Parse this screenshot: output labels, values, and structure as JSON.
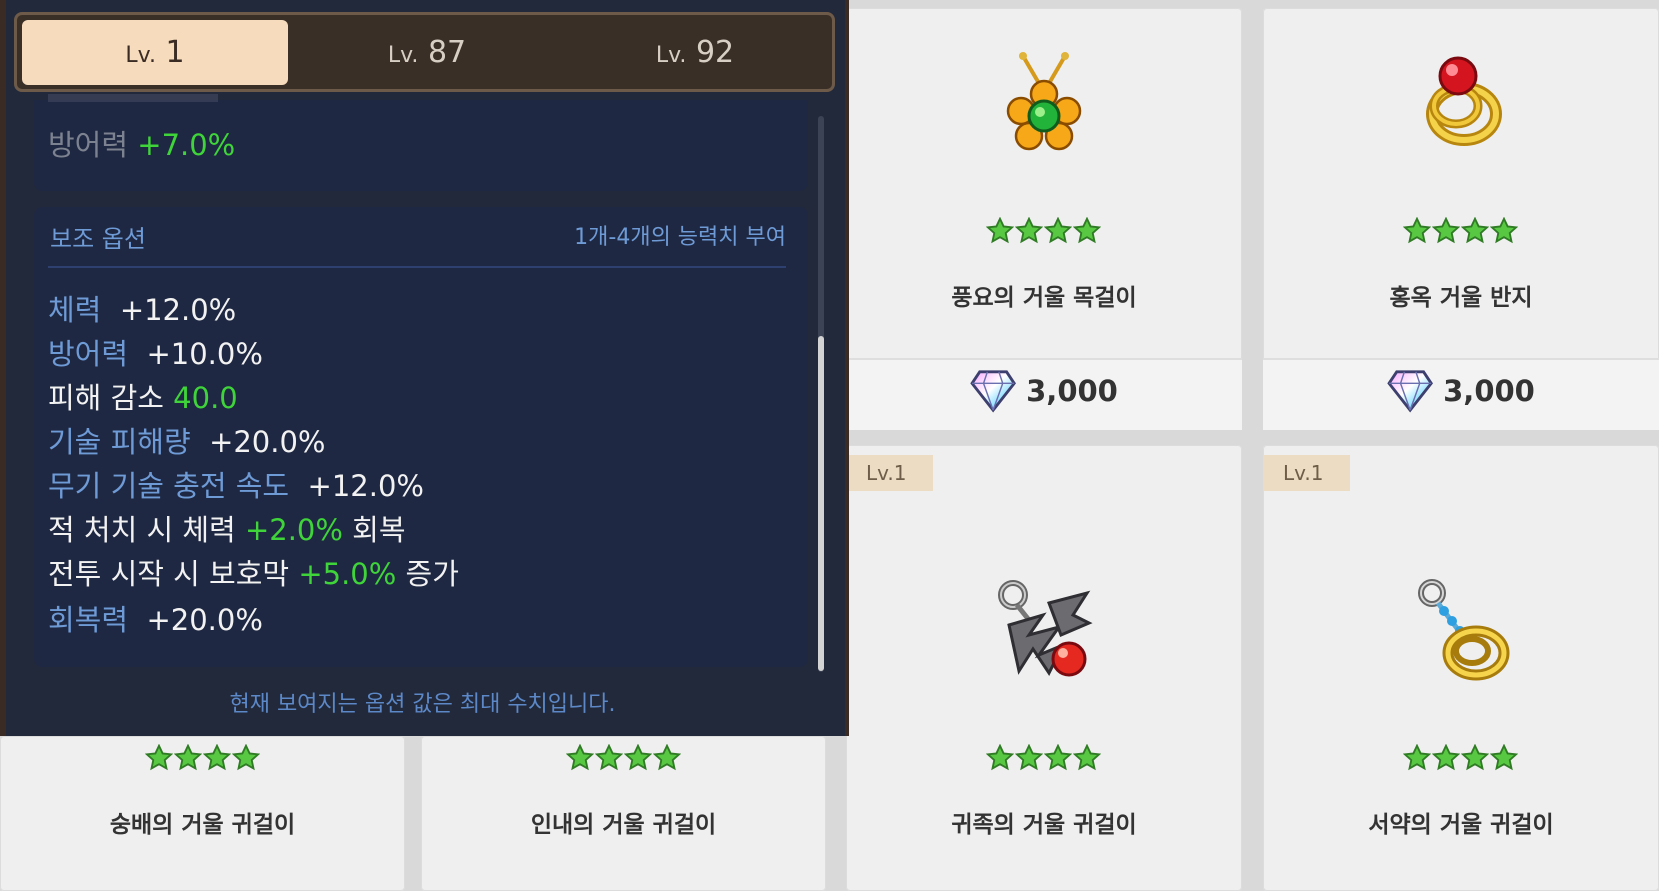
{
  "tabs": [
    {
      "prefix": "Lv.",
      "level": "1"
    },
    {
      "prefix": "Lv.",
      "level": "87"
    },
    {
      "prefix": "Lv.",
      "level": "92"
    }
  ],
  "main_options": {
    "defense_label": "방어력",
    "defense_value": "+7.0%"
  },
  "sub_options": {
    "title": "보조 옵션",
    "note": "1개-4개의 능력치 부여",
    "lines": [
      {
        "label": "체력",
        "value": "+12.0%"
      },
      {
        "label": "방어력",
        "value": "+10.0%"
      },
      {
        "label": "피해 감소",
        "value": "40.0"
      },
      {
        "label": "기술 피해량",
        "value": "+20.0%"
      },
      {
        "label": "무기 기술 충전 속도",
        "value": "+12.0%"
      },
      {
        "pre": "적 처치 시 체력",
        "value": "+2.0%",
        "post": "회복"
      },
      {
        "pre": "전투 시작 시 보호막",
        "value": "+5.0%",
        "post": "증가"
      },
      {
        "label": "회복력",
        "value": "+20.0%"
      }
    ]
  },
  "footer_note": "현재 보여지는 옵션 값은 최대 수치입니다.",
  "items": [
    {
      "name": "풍요의 거울 목걸이",
      "price": "3,000",
      "stars": 4
    },
    {
      "name": "홍옥 거울 반지",
      "price": "3,000",
      "stars": 4
    },
    {
      "name": "귀족의 거울 귀걸이",
      "level": "Lv.1",
      "stars": 4
    },
    {
      "name": "서약의 거울 귀걸이",
      "level": "Lv.1",
      "stars": 4
    },
    {
      "name": "숭배의 거울 귀걸이",
      "stars": 4
    },
    {
      "name": "인내의 거울 귀걸이",
      "stars": 4
    }
  ],
  "icons": {
    "necklace": "flower-necklace-icon",
    "ring": "ruby-ring-icon",
    "earring_noble": "bat-earring-icon",
    "earring_oath": "ring-earring-icon",
    "currency": "diamond-gem-icon",
    "star": "green-star-icon"
  },
  "colors": {
    "accent_blue": "#6e9ad6",
    "value_green": "#3ed43a",
    "tab_active": "#f6dcbd",
    "panel_bg": "#22293a"
  }
}
